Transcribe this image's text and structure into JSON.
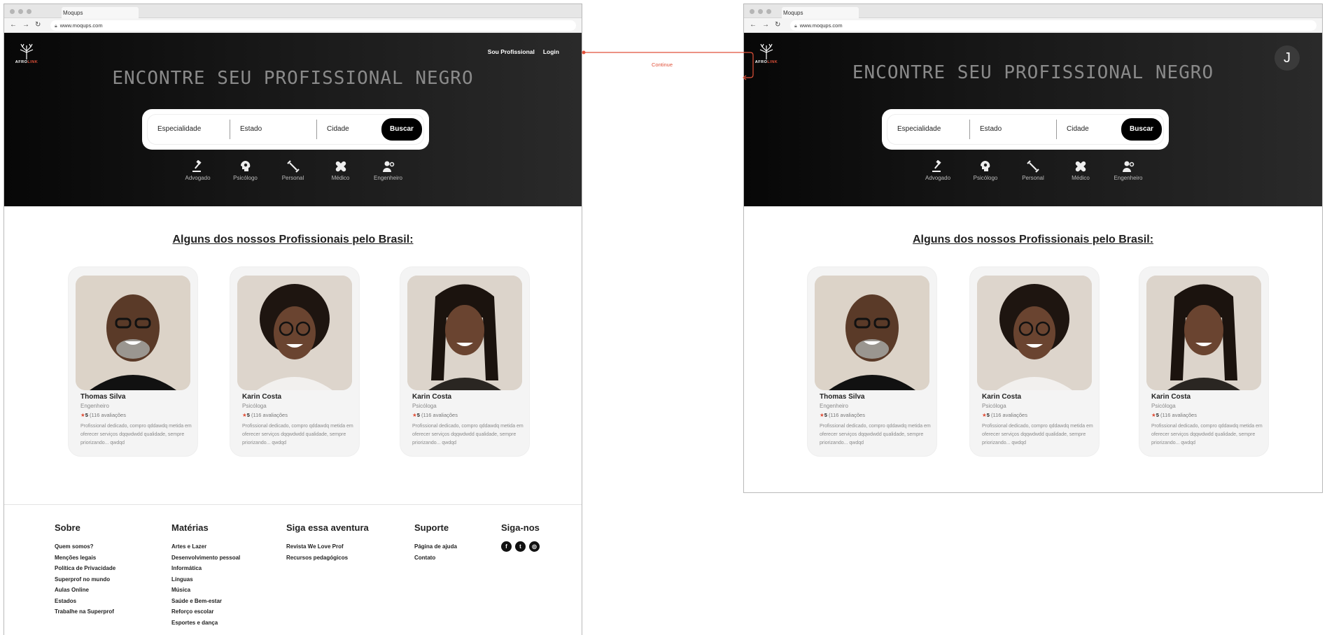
{
  "browser": {
    "tab_title": "Moqups",
    "url": "www.moqups.com"
  },
  "brand": {
    "logo_name": "AFRO",
    "logo_accent": "LINK",
    "accent_color": "#e0513a"
  },
  "nav": {
    "pro_link": "Sou Profissional",
    "login_link": "Login"
  },
  "user": {
    "avatar_initial": "J"
  },
  "hero": {
    "title": "ENCONTRE SEU PROFISSIONAL NEGRO"
  },
  "search": {
    "especialidade": "Especialidade",
    "estado": "Estado",
    "cidade": "Cidade",
    "button": "Buscar"
  },
  "categories": [
    {
      "label": "Advogado",
      "icon": "gavel-icon"
    },
    {
      "label": "Psicólogo",
      "icon": "brain-icon"
    },
    {
      "label": "Personal",
      "icon": "dumbbell-icon"
    },
    {
      "label": "Médico",
      "icon": "bandage-icon"
    },
    {
      "label": "Engenheiro",
      "icon": "engineer-icon"
    }
  ],
  "section": {
    "title": "Alguns dos nossos Profissionais pelo Brasil:"
  },
  "professionals": [
    {
      "name": "Thomas Silva",
      "role": "Engenheiro",
      "score": "5",
      "reviews": "(116 avaliações",
      "desc": "Profissional dedicado, compro qddawdq metida em oferecer serviços dqqwdwdd qualidade, sempre priorizando... qwdqd"
    },
    {
      "name": "Karin Costa",
      "role": "Psicóloga",
      "score": "5",
      "reviews": "(116 avaliações",
      "desc": "Profissional dedicado, compro qddawdq metida em oferecer serviços dqqwdwdd qualidade, sempre priorizando... qwdqd"
    },
    {
      "name": "Karin Costa",
      "role": "Psicóloga",
      "score": "5",
      "reviews": "(116 avaliações",
      "desc": "Profissional dedicado, compro qddawdq metida em oferecer serviços dqqwdwdd qualidade, sempre priorizando... qwdqd"
    }
  ],
  "connector": {
    "label": "Continue"
  },
  "footer": {
    "sobre": {
      "title": "Sobre",
      "links": [
        "Quem somos?",
        "Menções legais",
        "Política de Privacidade",
        "Superprof no mundo",
        "Aulas Online",
        "Estados",
        "Trabalhe na Superprof"
      ]
    },
    "materias": {
      "title": "Matérias",
      "links": [
        "Artes e Lazer",
        "Desenvolvimento pessoal",
        "Informática",
        "Línguas",
        "Música",
        "Saúde e Bem-estar",
        "Reforço escolar",
        "Esportes e dança"
      ]
    },
    "aventura": {
      "title": "Siga essa aventura",
      "links": [
        "Revista We Love Prof",
        "Recursos pedagógicos"
      ]
    },
    "suporte": {
      "title": "Suporte",
      "links": [
        "Página de ajuda",
        "Contato"
      ]
    },
    "sigarnos": {
      "title": "Siga-nos",
      "icons": [
        "facebook-icon",
        "twitter-icon",
        "instagram-icon"
      ]
    }
  }
}
